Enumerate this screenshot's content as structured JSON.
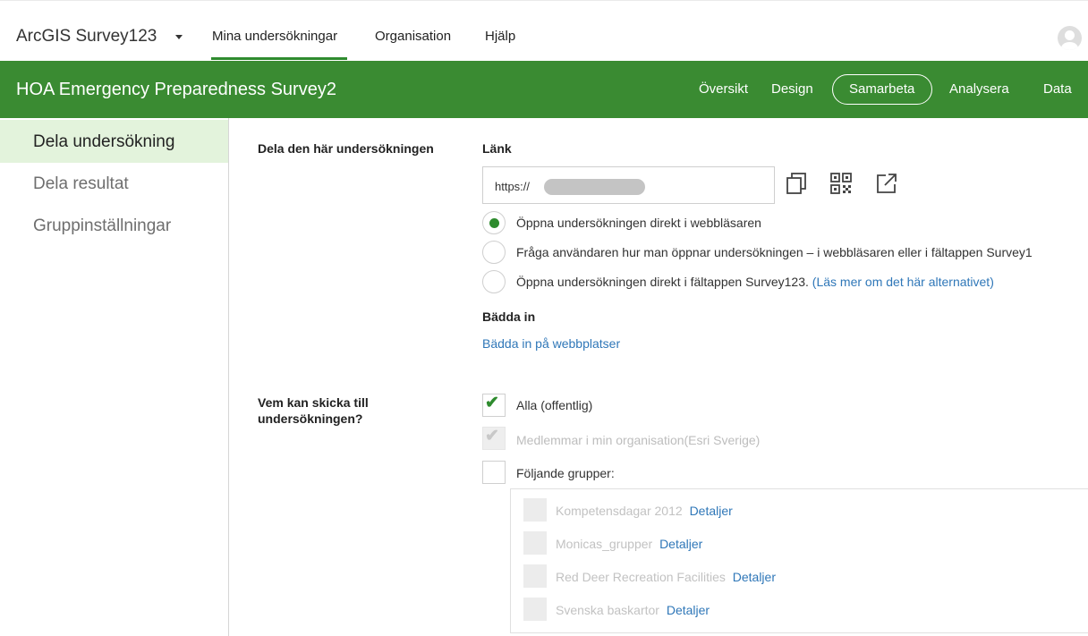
{
  "topnav": {
    "app_title": "ArcGIS Survey123",
    "links": [
      "Mina undersökningar",
      "Organisation",
      "Hjälp"
    ]
  },
  "header": {
    "survey_title": "HOA Emergency Preparedness Survey2",
    "tabs": [
      "Översikt",
      "Design",
      "Samarbeta",
      "Analysera",
      "Data"
    ],
    "active_tab": "Samarbeta"
  },
  "sidebar": {
    "items": [
      "Dela undersökning",
      "Dela resultat",
      "Gruppinställningar"
    ],
    "active": "Dela undersökning"
  },
  "share": {
    "section_label": "Dela den här undersökningen",
    "link_label": "Länk",
    "link_value": "https://",
    "options": [
      "Öppna undersökningen direkt i webbläsaren",
      "Fråga användaren hur man öppnar undersökningen – i webbläsaren eller i fältappen Survey1",
      "Öppna undersökningen direkt i fältappen Survey123."
    ],
    "option3_link": "(Läs mer om det här alternativet)",
    "selected_option": 0,
    "embed_label": "Bädda in",
    "embed_link": "Bädda in på webbplatser"
  },
  "access": {
    "label": "Vem kan skicka till undersökningen?",
    "options": [
      "Alla (offentlig)",
      "Medlemmar i min organisation(Esri Sverige)",
      "Följande grupper:"
    ],
    "groups": [
      {
        "name": "Kompetensdagar 2012",
        "details": "Detaljer"
      },
      {
        "name": "Monicas_grupper",
        "details": "Detaljer"
      },
      {
        "name": "Red Deer Recreation Facilities",
        "details": "Detaljer"
      },
      {
        "name": "Svenska baskartor",
        "details": "Detaljer"
      }
    ]
  },
  "colors": {
    "brand_green": "#3a8b32",
    "accent_green": "#2e8b2e",
    "link_blue": "#2f77b8"
  }
}
